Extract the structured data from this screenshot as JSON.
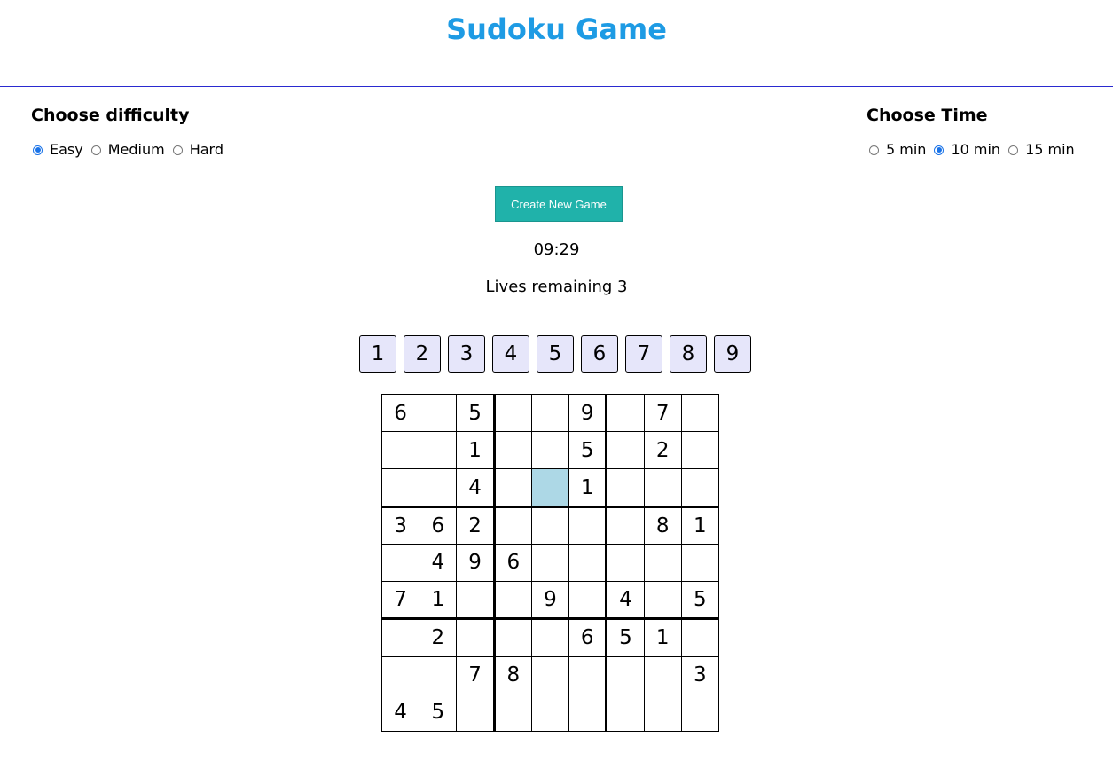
{
  "app": {
    "title": "Sudoku Game"
  },
  "difficulty": {
    "heading": "Choose difficulty",
    "options": [
      {
        "label": "Easy",
        "checked": true
      },
      {
        "label": "Medium",
        "checked": false
      },
      {
        "label": "Hard",
        "checked": false
      }
    ]
  },
  "time": {
    "heading": "Choose Time",
    "options": [
      {
        "label": "5 min",
        "checked": false
      },
      {
        "label": "10 min",
        "checked": true
      },
      {
        "label": "15 min",
        "checked": false
      }
    ]
  },
  "controls": {
    "new_game_label": "Create New Game"
  },
  "status": {
    "timer": "09:29",
    "lives": "Lives remaining 3"
  },
  "number_pad": [
    "1",
    "2",
    "3",
    "4",
    "5",
    "6",
    "7",
    "8",
    "9"
  ],
  "board": {
    "selected_cell": {
      "row": 2,
      "col": 4
    },
    "rows": [
      [
        "6",
        "",
        "5",
        "",
        "",
        "9",
        "",
        "7",
        ""
      ],
      [
        "",
        "",
        "1",
        "",
        "",
        "5",
        "",
        "2",
        ""
      ],
      [
        "",
        "",
        "4",
        "",
        "",
        "1",
        "",
        "",
        ""
      ],
      [
        "3",
        "6",
        "2",
        "",
        "",
        "",
        "",
        "8",
        "1"
      ],
      [
        "",
        "4",
        "9",
        "6",
        "",
        "",
        "",
        "",
        ""
      ],
      [
        "7",
        "1",
        "",
        "",
        "9",
        "",
        "4",
        "",
        "5"
      ],
      [
        "",
        "2",
        "",
        "",
        "",
        "6",
        "5",
        "1",
        ""
      ],
      [
        "",
        "",
        "7",
        "8",
        "",
        "",
        "",
        "",
        "3"
      ],
      [
        "4",
        "5",
        "",
        "",
        "",
        "",
        "",
        "",
        ""
      ]
    ]
  },
  "colors": {
    "title": "#1e9be4",
    "divider": "#2a2ad0",
    "button_bg": "#20b2aa",
    "number_pad_bg": "#e6e6fa",
    "selected_cell": "#add8e6",
    "radio_checked": "#1a73e8"
  }
}
